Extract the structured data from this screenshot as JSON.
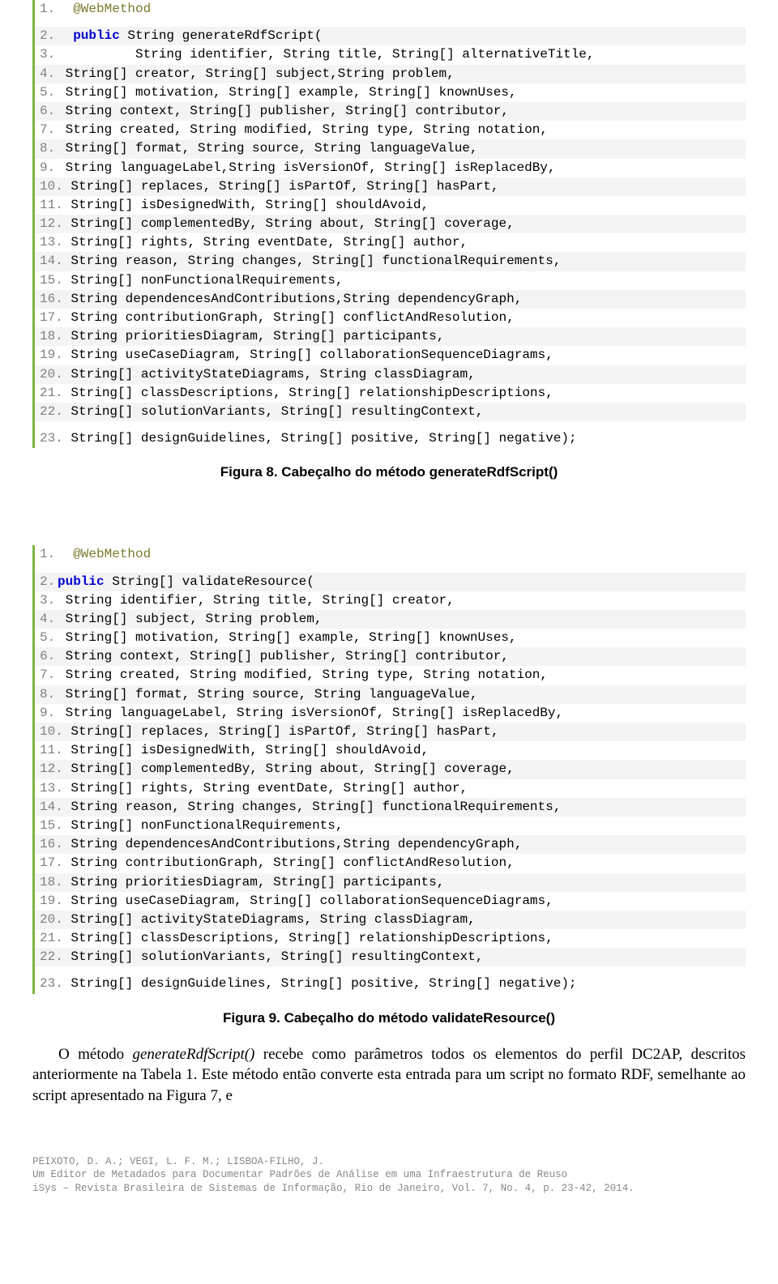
{
  "figure8": {
    "caption": "Figura 8. Cabeçalho do método generateRdfScript()",
    "lines": [
      {
        "n": "1.",
        "pre": "  ",
        "anno": "@WebMethod",
        "rest": ""
      },
      {
        "n": "2.",
        "pre": "  ",
        "pub": "public",
        "rest": " String generateRdfScript("
      },
      {
        "n": "3.",
        "pre": "          ",
        "rest": "String identifier, String title, String[] alternativeTitle,"
      },
      {
        "n": "4.",
        "pre": " ",
        "rest": "String[] creator, String[] subject,String problem,"
      },
      {
        "n": "5.",
        "pre": " ",
        "rest": "String[] motivation, String[] example, String[] knownUses,"
      },
      {
        "n": "6.",
        "pre": " ",
        "rest": "String context, String[] publisher, String[] contributor,"
      },
      {
        "n": "7.",
        "pre": " ",
        "rest": "String created, String modified, String type, String notation,"
      },
      {
        "n": "8.",
        "pre": " ",
        "rest": "String[] format, String source, String languageValue,"
      },
      {
        "n": "9.",
        "pre": " ",
        "rest": "String languageLabel,String isVersionOf, String[] isReplacedBy,"
      },
      {
        "n": "10.",
        "pre": " ",
        "rest": "String[] replaces, String[] isPartOf, String[] hasPart,"
      },
      {
        "n": "11.",
        "pre": " ",
        "rest": "String[] isDesignedWith, String[] shouldAvoid,"
      },
      {
        "n": "12.",
        "pre": " ",
        "rest": "String[] complementedBy, String about, String[] coverage,"
      },
      {
        "n": "13.",
        "pre": " ",
        "rest": "String[] rights, String eventDate, String[] author,"
      },
      {
        "n": "14.",
        "pre": " ",
        "rest": "String reason, String changes, String[] functionalRequirements,"
      },
      {
        "n": "15.",
        "pre": " ",
        "rest": "String[] nonFunctionalRequirements,"
      },
      {
        "n": "16.",
        "pre": " ",
        "rest": "String dependencesAndContributions,String dependencyGraph,"
      },
      {
        "n": "17.",
        "pre": " ",
        "rest": "String contributionGraph, String[] conflictAndResolution,"
      },
      {
        "n": "18.",
        "pre": " ",
        "rest": "String prioritiesDiagram, String[] participants,"
      },
      {
        "n": "19.",
        "pre": " ",
        "rest": "String useCaseDiagram, String[] collaborationSequenceDiagrams,"
      },
      {
        "n": "20.",
        "pre": " ",
        "rest": "String[] activityStateDiagrams, String classDiagram,"
      },
      {
        "n": "21.",
        "pre": " ",
        "rest": "String[] classDescriptions, String[] relationshipDescriptions,"
      },
      {
        "n": "22.",
        "pre": " ",
        "rest": "String[] solutionVariants, String[] resultingContext,"
      },
      {
        "n": "23.",
        "pre": " ",
        "rest": "String[] designGuidelines, String[] positive, String[] negative);"
      }
    ]
  },
  "figure9": {
    "caption": "Figura 9. Cabeçalho do método validateResource()",
    "lines": [
      {
        "n": "1.",
        "pre": "  ",
        "anno": "@WebMethod",
        "rest": ""
      },
      {
        "n": "2.",
        "pre": "",
        "pub": "public",
        "rest": " String[] validateResource("
      },
      {
        "n": "3.",
        "pre": " ",
        "rest": "String identifier, String title, String[] creator,"
      },
      {
        "n": "4.",
        "pre": " ",
        "rest": "String[] subject, String problem,"
      },
      {
        "n": "5.",
        "pre": " ",
        "rest": "String[] motivation, String[] example, String[] knownUses,"
      },
      {
        "n": "6.",
        "pre": " ",
        "rest": "String context, String[] publisher, String[] contributor,"
      },
      {
        "n": "7.",
        "pre": " ",
        "rest": "String created, String modified, String type, String notation,"
      },
      {
        "n": "8.",
        "pre": " ",
        "rest": "String[] format, String source, String languageValue,"
      },
      {
        "n": "9.",
        "pre": " ",
        "rest": "String languageLabel, String isVersionOf, String[] isReplacedBy,"
      },
      {
        "n": "10.",
        "pre": " ",
        "rest": "String[] replaces, String[] isPartOf, String[] hasPart,"
      },
      {
        "n": "11.",
        "pre": " ",
        "rest": "String[] isDesignedWith, String[] shouldAvoid,"
      },
      {
        "n": "12.",
        "pre": " ",
        "rest": "String[] complementedBy, String about, String[] coverage,"
      },
      {
        "n": "13.",
        "pre": " ",
        "rest": "String[] rights, String eventDate, String[] author,"
      },
      {
        "n": "14.",
        "pre": " ",
        "rest": "String reason, String changes, String[] functionalRequirements,"
      },
      {
        "n": "15.",
        "pre": " ",
        "rest": "String[] nonFunctionalRequirements,"
      },
      {
        "n": "16.",
        "pre": " ",
        "rest": "String dependencesAndContributions,String dependencyGraph,"
      },
      {
        "n": "17.",
        "pre": " ",
        "rest": "String contributionGraph, String[] conflictAndResolution,"
      },
      {
        "n": "18.",
        "pre": " ",
        "rest": "String prioritiesDiagram, String[] participants,"
      },
      {
        "n": "19.",
        "pre": " ",
        "rest": "String useCaseDiagram, String[] collaborationSequenceDiagrams,"
      },
      {
        "n": "20.",
        "pre": " ",
        "rest": "String[] activityStateDiagrams, String classDiagram,"
      },
      {
        "n": "21.",
        "pre": " ",
        "rest": "String[] classDescriptions, String[] relationshipDescriptions,"
      },
      {
        "n": "22.",
        "pre": " ",
        "rest": "String[] solutionVariants, String[] resultingContext,"
      },
      {
        "n": "23.",
        "pre": " ",
        "rest": "String[] designGuidelines, String[] positive, String[] negative);"
      }
    ]
  },
  "body": {
    "p1a": "O método ",
    "p1_em": "generateRdfScript()",
    "p1b": " recebe como parâmetros todos os elementos do perfil DC2AP, descritos anteriormente na Tabela 1. Este método então converte esta entrada para um script no formato RDF, semelhante ao script apresentado na Figura 7, e"
  },
  "footer": {
    "l1": "PEIXOTO, D. A.; VEGI, L. F. M.; LISBOA-FILHO, J.",
    "l2": "Um Editor de Metadados para Documentar Padrões de Análise em uma Infraestrutura de Reuso",
    "l3": "iSys – Revista Brasileira de Sistemas de Informação, Rio de Janeiro, Vol. 7, No. 4, p. 23-42, 2014."
  }
}
